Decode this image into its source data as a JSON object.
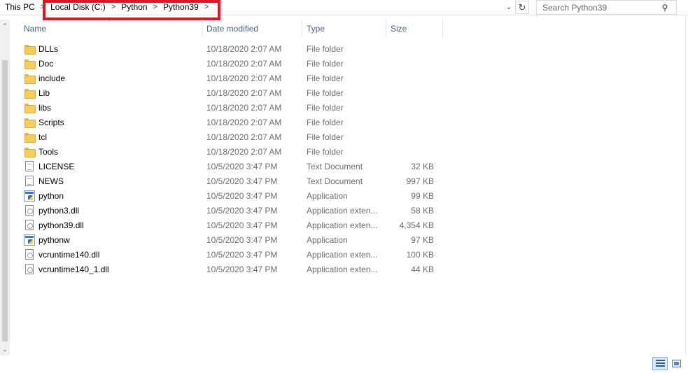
{
  "address": {
    "crumbs": [
      "This PC",
      "Local Disk (C:)",
      "Python",
      "Python39"
    ],
    "separator": ">"
  },
  "search": {
    "placeholder": "Search Python39"
  },
  "columns": {
    "name": "Name",
    "date": "Date modified",
    "type": "Type",
    "size": "Size"
  },
  "files": [
    {
      "name": "DLLs",
      "date": "10/18/2020 2:07 AM",
      "type": "File folder",
      "size": "",
      "icon": "folder-icon"
    },
    {
      "name": "Doc",
      "date": "10/18/2020 2:07 AM",
      "type": "File folder",
      "size": "",
      "icon": "folder-icon"
    },
    {
      "name": "include",
      "date": "10/18/2020 2:07 AM",
      "type": "File folder",
      "size": "",
      "icon": "folder-icon"
    },
    {
      "name": "Lib",
      "date": "10/18/2020 2:07 AM",
      "type": "File folder",
      "size": "",
      "icon": "folder-icon"
    },
    {
      "name": "libs",
      "date": "10/18/2020 2:07 AM",
      "type": "File folder",
      "size": "",
      "icon": "folder-icon"
    },
    {
      "name": "Scripts",
      "date": "10/18/2020 2:07 AM",
      "type": "File folder",
      "size": "",
      "icon": "folder-icon"
    },
    {
      "name": "tcl",
      "date": "10/18/2020 2:07 AM",
      "type": "File folder",
      "size": "",
      "icon": "folder-icon"
    },
    {
      "name": "Tools",
      "date": "10/18/2020 2:07 AM",
      "type": "File folder",
      "size": "",
      "icon": "folder-icon"
    },
    {
      "name": "LICENSE",
      "date": "10/5/2020 3:47 PM",
      "type": "Text Document",
      "size": "32 KB",
      "icon": "text-document-icon"
    },
    {
      "name": "NEWS",
      "date": "10/5/2020 3:47 PM",
      "type": "Text Document",
      "size": "997 KB",
      "icon": "text-document-icon"
    },
    {
      "name": "python",
      "date": "10/5/2020 3:47 PM",
      "type": "Application",
      "size": "99 KB",
      "icon": "python-app-icon"
    },
    {
      "name": "python3.dll",
      "date": "10/5/2020 3:47 PM",
      "type": "Application exten...",
      "size": "58 KB",
      "icon": "dll-file-icon"
    },
    {
      "name": "python39.dll",
      "date": "10/5/2020 3:47 PM",
      "type": "Application exten...",
      "size": "4,354 KB",
      "icon": "dll-file-icon"
    },
    {
      "name": "pythonw",
      "date": "10/5/2020 3:47 PM",
      "type": "Application",
      "size": "97 KB",
      "icon": "python-app-icon"
    },
    {
      "name": "vcruntime140.dll",
      "date": "10/5/2020 3:47 PM",
      "type": "Application exten...",
      "size": "100 KB",
      "icon": "dll-file-icon"
    },
    {
      "name": "vcruntime140_1.dll",
      "date": "10/5/2020 3:47 PM",
      "type": "Application exten...",
      "size": "44 KB",
      "icon": "dll-file-icon"
    }
  ],
  "colors": {
    "highlight": "#e81123",
    "header_text": "#4c607a",
    "secondary_text": "#6d6d6d",
    "selected_view": "#d8eaf9"
  },
  "icons": {
    "search": "magnifier-icon",
    "refresh": "refresh-icon",
    "dropdown": "chevron-down-icon"
  }
}
